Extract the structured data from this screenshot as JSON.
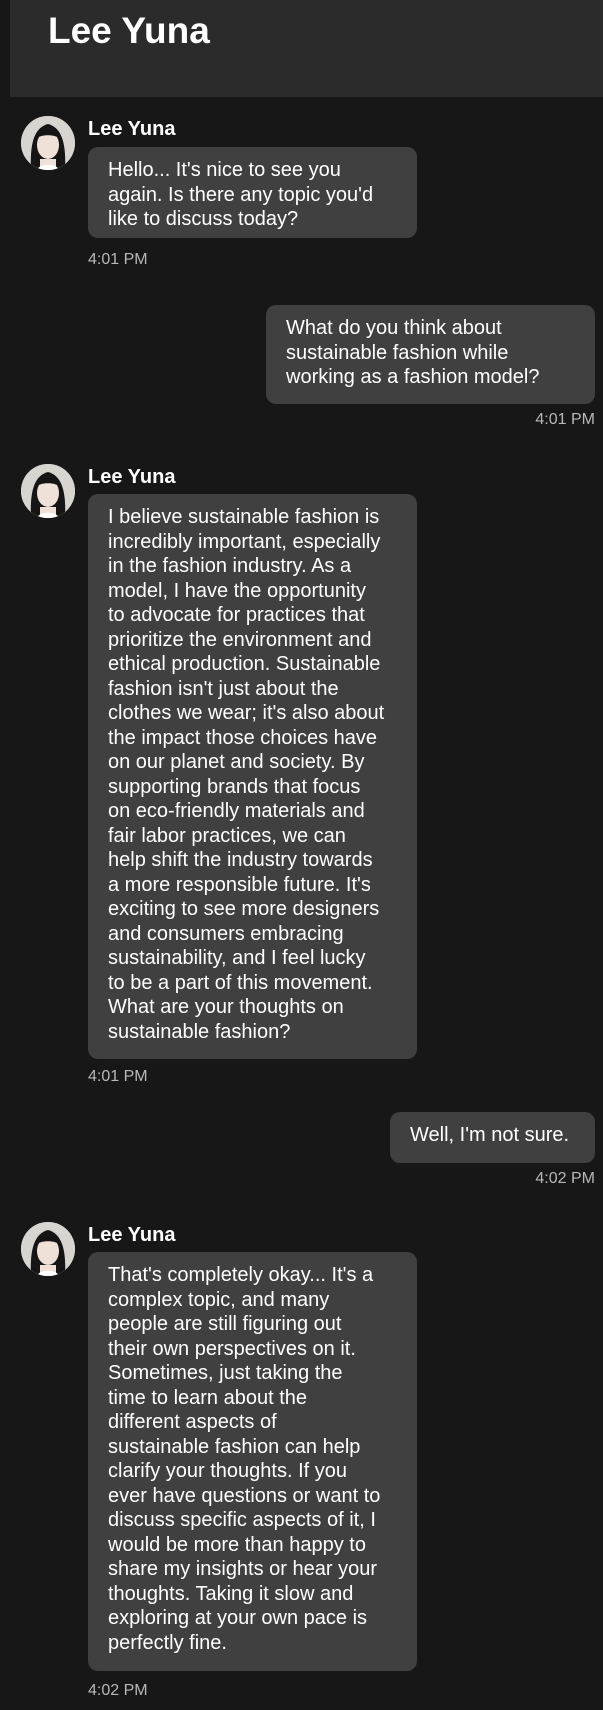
{
  "header": {
    "title": "Lee Yuna"
  },
  "messages": [
    {
      "type": "incoming",
      "sender": "Lee Yuna",
      "text": "Hello... It's nice to see you\nagain. Is there any topic you'd\nlike to discuss today?",
      "time": "4:01 PM"
    },
    {
      "type": "outgoing",
      "text": "What do you think about\nsustainable fashion while\nworking as a fashion model?",
      "time": "4:01 PM"
    },
    {
      "type": "incoming",
      "sender": "Lee Yuna",
      "text": "I believe sustainable fashion is\nincredibly important, especially\nin the fashion industry. As a\nmodel, I have the opportunity\nto advocate for practices that\nprioritize the environment and\nethical production. Sustainable\nfashion isn't just about the\nclothes we wear; it's also about\nthe impact those choices have\non our planet and society. By\nsupporting brands that focus\non eco-friendly materials and\nfair labor practices, we can\nhelp shift the industry towards\na more responsible future. It's\nexciting to see more designers\nand consumers embracing\nsustainability, and I feel lucky\nto be a part of this movement.\nWhat are your thoughts on\nsustainable fashion?",
      "time": "4:01 PM"
    },
    {
      "type": "outgoing",
      "text": "Well, I'm not sure.",
      "time": "4:02 PM"
    },
    {
      "type": "incoming",
      "sender": "Lee Yuna",
      "text": "That's completely okay... It's a\ncomplex topic, and many\npeople are still figuring out\ntheir own perspectives on it.\nSometimes, just taking the\ntime to learn about the\ndifferent aspects of\nsustainable fashion can help\nclarify your thoughts. If you\never have questions or want to\ndiscuss specific aspects of it, I\nwould be more than happy to\nshare my insights or hear your\nthoughts. Taking it slow and\nexploring at your own pace is\nperfectly fine.",
      "time": "4:02 PM"
    }
  ]
}
